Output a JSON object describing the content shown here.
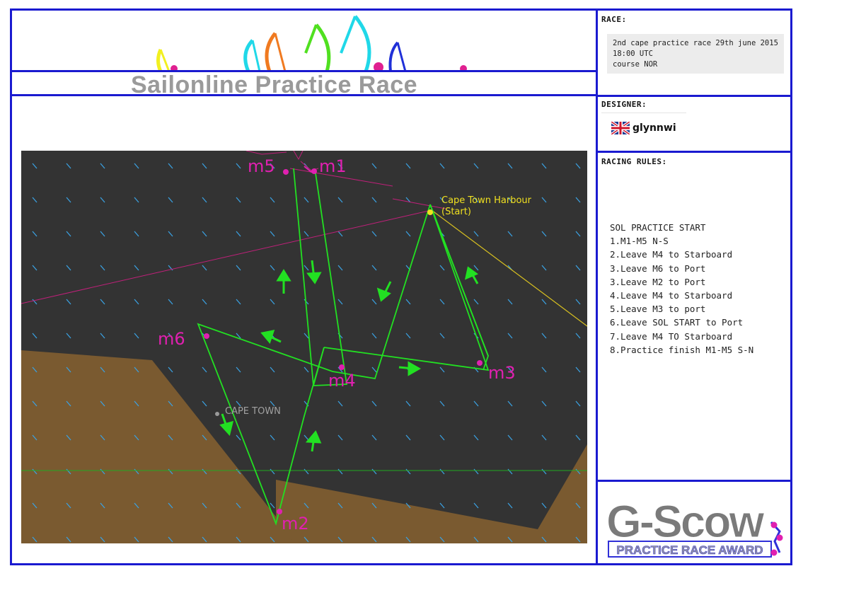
{
  "banner": {
    "title": "Sailonline Practice Race"
  },
  "race": {
    "label": "RACE:",
    "lines": [
      "2nd cape practice race 29th june 2015",
      "18:00 UTC",
      "course NOR"
    ]
  },
  "designer": {
    "label": "DESIGNER:",
    "name": "glynnwi",
    "flag_icon": "uk-flag-icon"
  },
  "racing_rules": {
    "label": "RACING RULES:",
    "lines": [
      "SOL PRACTICE START",
      "1.M1-M5 N-S",
      "2.Leave M4 to Starboard",
      "3.Leave M6 to Port",
      "3.Leave M2 to Port",
      "4.Leave M4 to Starboard",
      "5.Leave M3 to port",
      "6.Leave SOL START to Port",
      "7.Leave M4 TO Starboard",
      "8.Practice finish M1-M5 S-N"
    ]
  },
  "map": {
    "marks": {
      "m1": "m1",
      "m2": "m2",
      "m3": "m3",
      "m4": "m4",
      "m5": "m5",
      "m6": "m6"
    },
    "start_label_line1": "Cape Town Harbour",
    "start_label_line2": "(Start)",
    "city_label": "CAPE TOWN",
    "colors": {
      "sea": "#333333",
      "land": "#7a5a30",
      "course": "#22e022",
      "marks": "#e020b0",
      "start": "#f0e020",
      "wind": "#3aa0e0"
    }
  },
  "award": {
    "logo_text": "G-Scow",
    "subtitle": "PRACTICE RACE AWARD"
  },
  "colors": {
    "frame": "#1a1ad0",
    "banner_text": "#9a9a9a"
  }
}
